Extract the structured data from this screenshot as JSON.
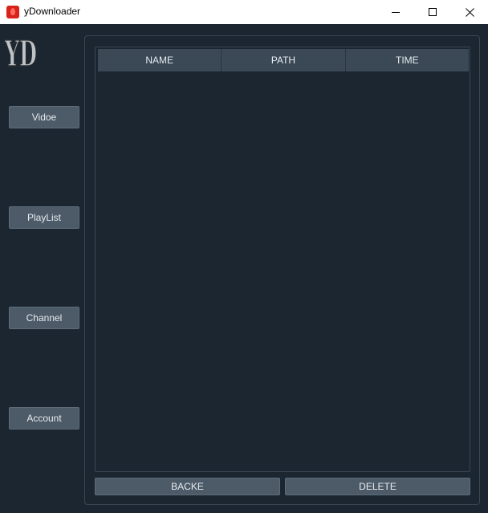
{
  "window": {
    "title": "yDownloader",
    "controls": [
      "minimize-icon",
      "maximize-icon",
      "close-icon"
    ]
  },
  "logo": {
    "text": "YD"
  },
  "sidebar": {
    "items": [
      {
        "label": "Vidoe"
      },
      {
        "label": "PlayList"
      },
      {
        "label": "Channel"
      },
      {
        "label": "Account"
      }
    ]
  },
  "table": {
    "columns": [
      "NAME",
      "PATH",
      "TIME"
    ],
    "rows": []
  },
  "actions": {
    "back_label": "BACKE",
    "delete_label": "DELETE"
  },
  "colors": {
    "background": "#1b2631",
    "button": "#4d5b68",
    "header": "#3b4956",
    "text": "#e6ebef",
    "app_icon": "#d8221b"
  }
}
